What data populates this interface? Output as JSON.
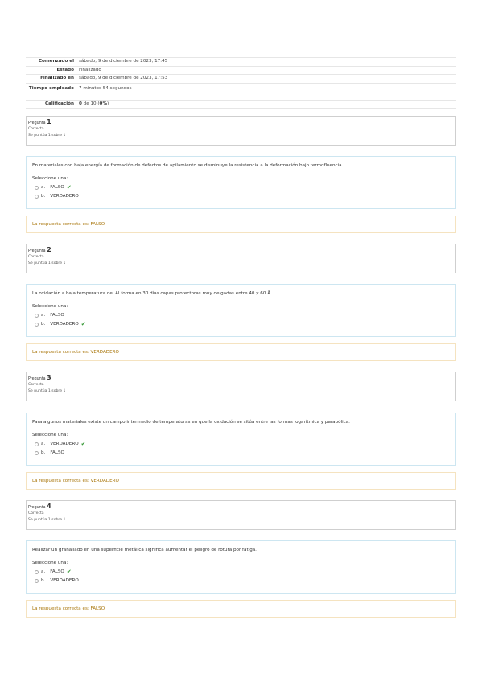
{
  "summary": [
    {
      "label": "Comenzado el",
      "value": "sábado, 9 de diciembre de 2023, 17:45"
    },
    {
      "label": "Estado",
      "value": "Finalizado"
    },
    {
      "label": "Finalizado en",
      "value": "sábado, 9 de diciembre de 2023, 17:53"
    },
    {
      "label": "Tiempo empleado",
      "value": "7 minutos 54 segundos"
    },
    {
      "label": "Calificación",
      "value_bold": "0",
      "value_rest": " de 10 (",
      "value_pct": "0%",
      "value_end": ")"
    }
  ],
  "questions": [
    {
      "label": "Pregunta",
      "number": "1",
      "state": "Correcta",
      "points": "Se puntúa 1 sobre 1",
      "text": "En materiales con baja energía de formación de defectos de apilamiento se disminuye la resistencia a la deformación bajo termofluencia.",
      "prompt": "Seleccione una:",
      "answers": [
        {
          "letter": "a.",
          "text": "FALSO",
          "check": "✔"
        },
        {
          "letter": "b.",
          "text": "VERDADERO",
          "check": ""
        }
      ],
      "feedback": "La respuesta correcta es: FALSO"
    },
    {
      "label": "Pregunta",
      "number": "2",
      "state": "Correcta",
      "points": "Se puntúa 1 sobre 1",
      "text": "La oxidación a baja temperatura del Al forma en 30 días capas protectoras muy delgadas entre 40 y 60 Å.",
      "prompt": "Seleccione una:",
      "answers": [
        {
          "letter": "a.",
          "text": "FALSO",
          "check": ""
        },
        {
          "letter": "b.",
          "text": "VERDADERO",
          "check": "✔"
        }
      ],
      "feedback": "La respuesta correcta es: VERDADERO"
    },
    {
      "label": "Pregunta",
      "number": "3",
      "state": "Correcta",
      "points": "Se puntúa 1 sobre 1",
      "text": "Para algunos materiales existe un campo intermedio de temperaturas en que la oxidación se sitúa entre las formas logarítmica y parabólica.",
      "prompt": "Seleccione una:",
      "answers": [
        {
          "letter": "a.",
          "text": "VERDADERO",
          "check": "✔"
        },
        {
          "letter": "b.",
          "text": "FALSO",
          "check": ""
        }
      ],
      "feedback": "La respuesta correcta es: VERDADERO"
    },
    {
      "label": "Pregunta",
      "number": "4",
      "state": "Correcta",
      "points": "Se puntúa 1 sobre 1",
      "text": "Realizar un granallado en una superficie metálica significa aumentar el peligro de rotura por fatiga.",
      "prompt": "Seleccione una:",
      "answers": [
        {
          "letter": "a.",
          "text": "FALSO",
          "check": "✔"
        },
        {
          "letter": "b.",
          "text": "VERDADERO",
          "check": ""
        }
      ],
      "feedback": "La respuesta correcta es: FALSO"
    }
  ]
}
